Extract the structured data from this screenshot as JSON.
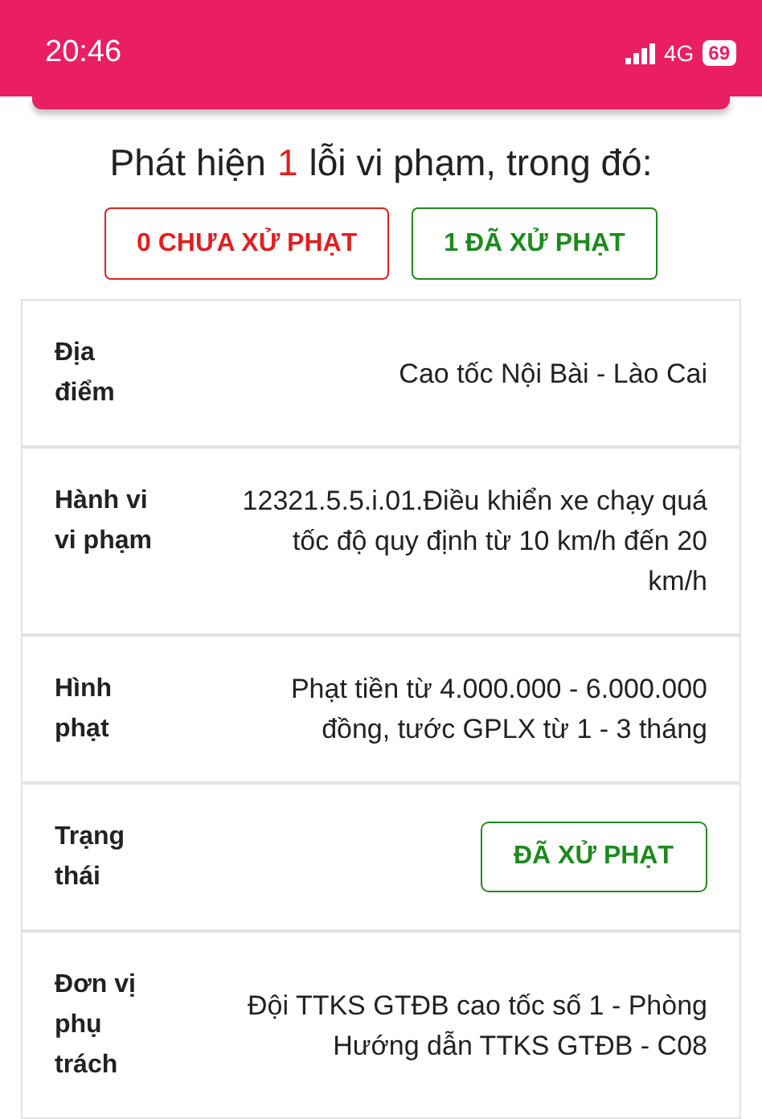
{
  "status_bar": {
    "time": "20:46",
    "network": "4G",
    "battery": "69"
  },
  "summary": {
    "prefix": "Phát hiện",
    "count": "1",
    "suffix": "lỗi vi phạm, trong đó:"
  },
  "filters": [
    {
      "label": "0 CHƯA XỬ PHẠT",
      "color": "#e02020"
    },
    {
      "label": "1 ĐÃ XỬ PHẠT",
      "color": "#1e8a1e"
    }
  ],
  "details": [
    {
      "kind": "text",
      "label": "Địa điểm",
      "value": "Cao tốc Nội Bài - Lào Cai"
    },
    {
      "kind": "text",
      "label": "Hành vi vi phạm",
      "value": "12321.5.5.i.01.Điều khiển xe chạy quá tốc độ quy định từ 10 km/h đến 20 km/h"
    },
    {
      "kind": "text",
      "label": "Hình phạt",
      "value": "Phạt tiền từ 4.000.000 - 6.000.000 đồng, tước GPLX từ 1 - 3 tháng"
    },
    {
      "kind": "status",
      "label": "Trạng thái",
      "value": "ĐÃ XỬ PHẠT",
      "color": "#1e8a1e"
    },
    {
      "kind": "text",
      "label": "Đơn vị phụ trách",
      "value": "Đội TTKS GTĐB cao tốc số 1 - Phòng Hướng dẫn TTKS GTĐB - C08"
    }
  ]
}
